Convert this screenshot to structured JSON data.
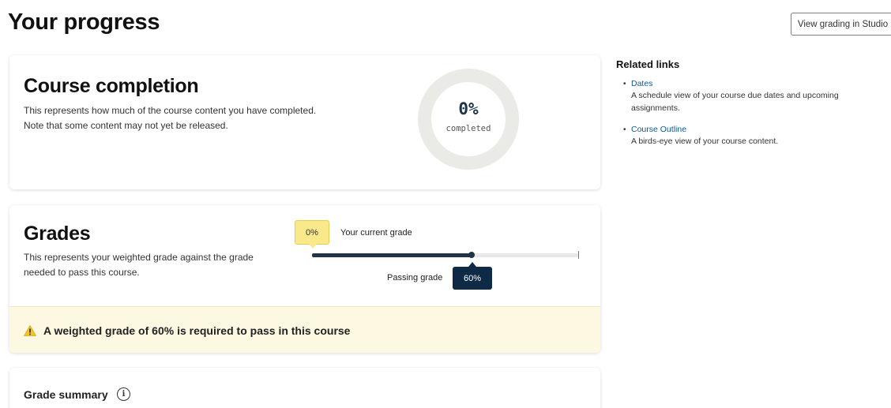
{
  "page": {
    "title": "Your progress",
    "studio_button": "View grading in Studio"
  },
  "completion": {
    "title": "Course completion",
    "description_line1": "This represents how much of the course content you have completed.",
    "description_line2": "Note that some content may not yet be released.",
    "percent_text": "0%",
    "percent_value": 0,
    "label": "completed"
  },
  "grades": {
    "title": "Grades",
    "description_line1": "This represents your weighted grade against the grade",
    "description_line2": "needed to pass this course.",
    "current_grade_text": "0%",
    "current_grade_value": 0,
    "current_grade_label": "Your current grade",
    "passing_grade_label": "Passing grade",
    "passing_grade_text": "60%",
    "passing_grade_value": 60,
    "alert_text": "A weighted grade of 60% is required to pass in this course"
  },
  "grade_summary": {
    "title": "Grade summary"
  },
  "related_links": {
    "title": "Related links",
    "items": [
      {
        "link": "Dates",
        "description_line1": "A schedule view of your course due dates and upcoming",
        "description_line2": "assignments."
      },
      {
        "link": "Course Outline",
        "description_line1": "A birds-eye view of your course content.",
        "description_line2": ""
      }
    ]
  },
  "icons": {
    "alert": "warning-triangle-icon",
    "info": "info-icon"
  },
  "colors": {
    "primary_dark": "#0e2a47",
    "progress_fill": "#1f3448",
    "current_grade_tooltip": "#fae98a",
    "alert_background": "#fdf8e1",
    "link": "#0a5a96",
    "warning_icon": "#f2c230"
  }
}
